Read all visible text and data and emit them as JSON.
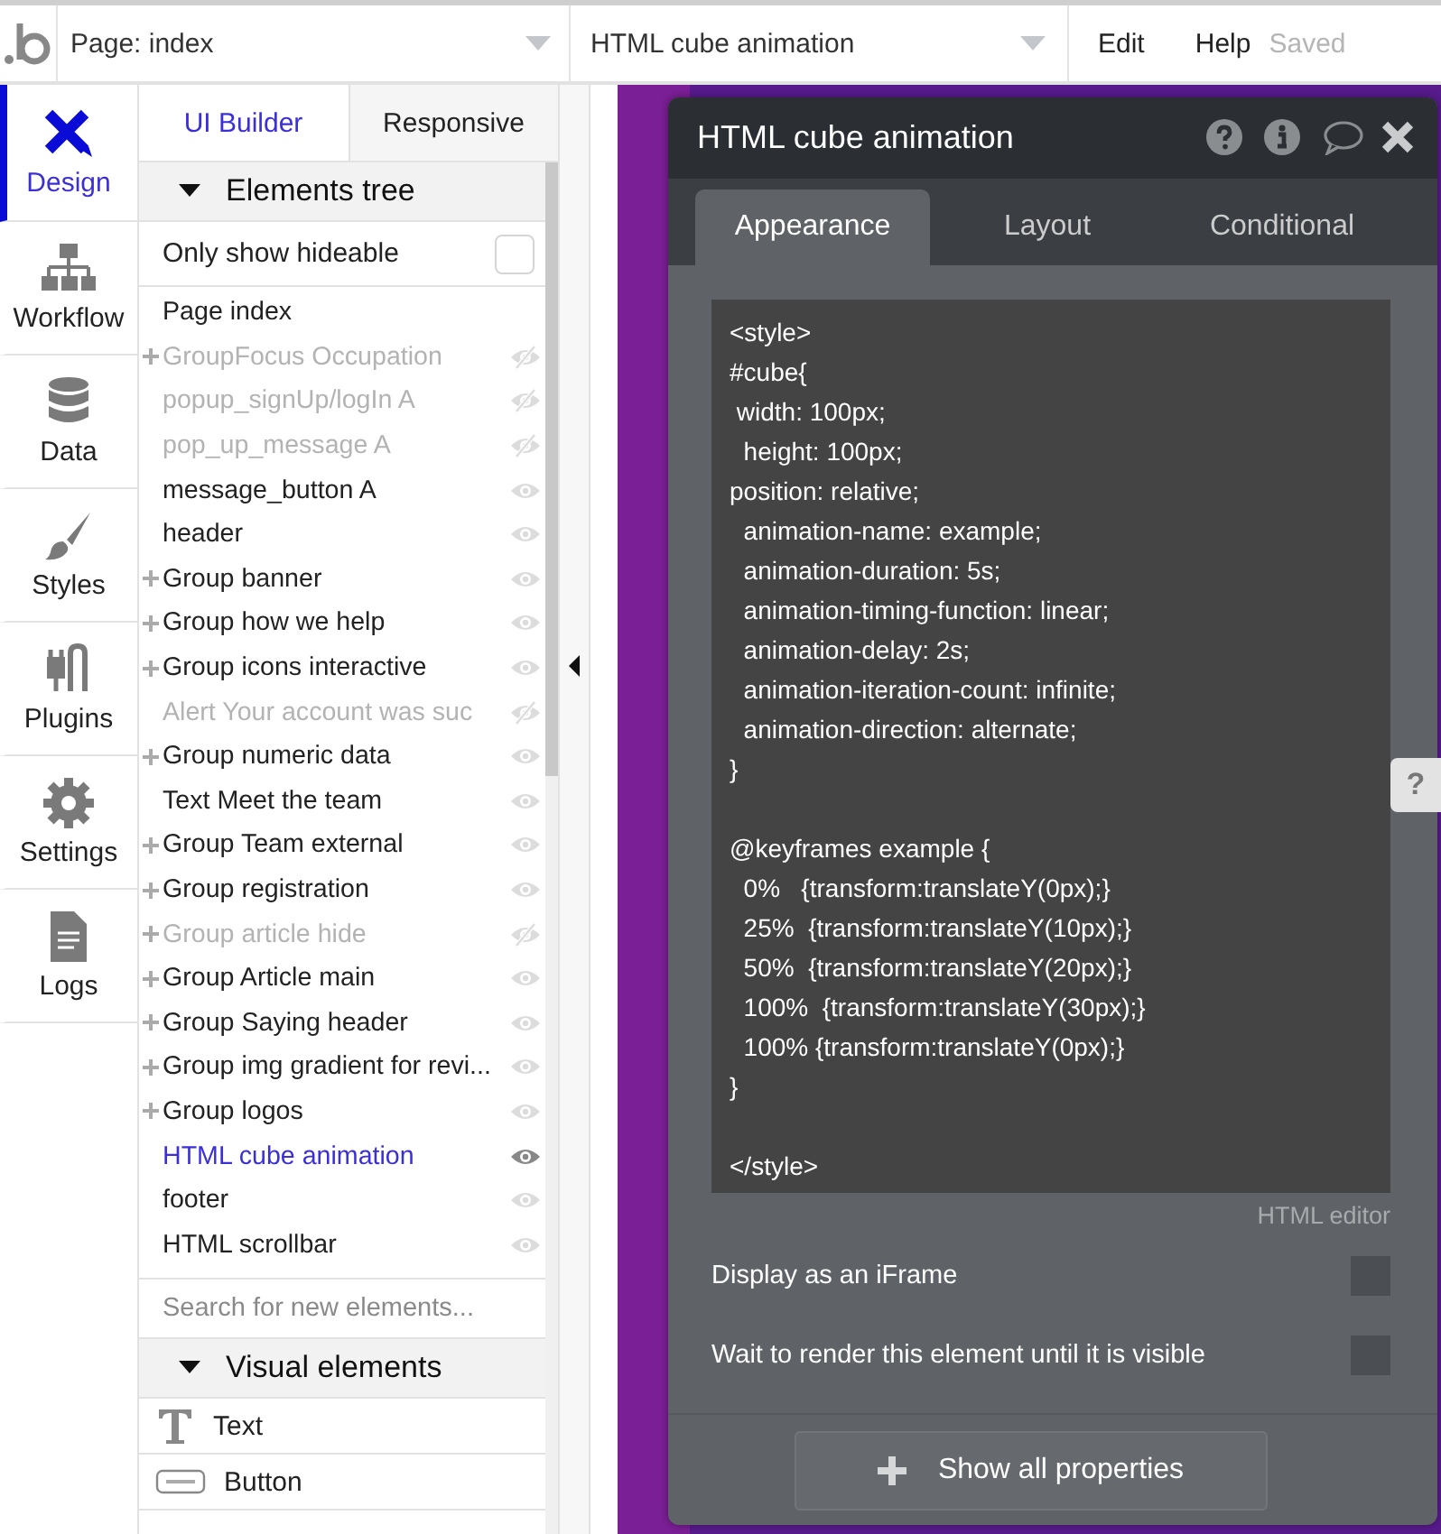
{
  "topbar": {
    "page_select": "Page: index",
    "element_select": "HTML cube animation",
    "menu": [
      {
        "label": "Edit",
        "kind": "menu"
      },
      {
        "label": "Help",
        "kind": "menu"
      },
      {
        "label": "Saved",
        "kind": "status"
      }
    ]
  },
  "sidebar": {
    "items": [
      {
        "label": "Design",
        "selected": true
      },
      {
        "label": "Workflow",
        "selected": false
      },
      {
        "label": "Data",
        "selected": false
      },
      {
        "label": "Styles",
        "selected": false
      },
      {
        "label": "Plugins",
        "selected": false
      },
      {
        "label": "Settings",
        "selected": false
      },
      {
        "label": "Logs",
        "selected": false
      }
    ]
  },
  "builder_tabs": [
    {
      "label": "UI Builder",
      "selected": true
    },
    {
      "label": "Responsive",
      "selected": false
    }
  ],
  "elements_tree": {
    "title": "Elements tree",
    "expanded": true,
    "only_show_hideable": {
      "label": "Only show hideable",
      "checked": false
    },
    "items": [
      {
        "label": "Page index",
        "kind": "page",
        "group": false,
        "hidden": false,
        "selected": false
      },
      {
        "label": "GroupFocus Occupation",
        "kind": "element",
        "group": true,
        "hidden": true,
        "selected": false
      },
      {
        "label": "popup_signUp/logIn A",
        "kind": "element",
        "group": false,
        "hidden": true,
        "selected": false
      },
      {
        "label": "pop_up_message A",
        "kind": "element",
        "group": false,
        "hidden": true,
        "selected": false
      },
      {
        "label": "message_button A",
        "kind": "element",
        "group": false,
        "hidden": false,
        "selected": false
      },
      {
        "label": "header",
        "kind": "element",
        "group": false,
        "hidden": false,
        "selected": false
      },
      {
        "label": "Group banner",
        "kind": "element",
        "group": true,
        "hidden": false,
        "selected": false
      },
      {
        "label": "Group how we help",
        "kind": "element",
        "group": true,
        "hidden": false,
        "selected": false
      },
      {
        "label": "Group icons interactive",
        "kind": "element",
        "group": true,
        "hidden": false,
        "selected": false
      },
      {
        "label": "Alert Your account was suc",
        "kind": "element",
        "group": false,
        "hidden": true,
        "selected": false
      },
      {
        "label": "Group numeric data",
        "kind": "element",
        "group": true,
        "hidden": false,
        "selected": false
      },
      {
        "label": "Text Meet the team",
        "kind": "element",
        "group": false,
        "hidden": false,
        "selected": false
      },
      {
        "label": "Group Team external",
        "kind": "element",
        "group": true,
        "hidden": false,
        "selected": false
      },
      {
        "label": "Group registration",
        "kind": "element",
        "group": true,
        "hidden": false,
        "selected": false
      },
      {
        "label": "Group article hide",
        "kind": "element",
        "group": true,
        "hidden": true,
        "selected": false
      },
      {
        "label": "Group Article main",
        "kind": "element",
        "group": true,
        "hidden": false,
        "selected": false
      },
      {
        "label": "Group Saying header",
        "kind": "element",
        "group": true,
        "hidden": false,
        "selected": false
      },
      {
        "label": "Group img gradient for revi...",
        "kind": "element",
        "group": true,
        "hidden": false,
        "selected": false
      },
      {
        "label": "Group logos",
        "kind": "element",
        "group": true,
        "hidden": false,
        "selected": false
      },
      {
        "label": "HTML cube animation",
        "kind": "element",
        "group": false,
        "hidden": false,
        "selected": true
      },
      {
        "label": "footer",
        "kind": "element",
        "group": false,
        "hidden": false,
        "selected": false
      },
      {
        "label": "HTML scrollbar",
        "kind": "element",
        "group": false,
        "hidden": false,
        "selected": false
      }
    ]
  },
  "search": {
    "placeholder": "Search for new elements..."
  },
  "visual_elements": {
    "title": "Visual elements",
    "expanded": true,
    "items": [
      {
        "label": "Text",
        "kind": "text"
      },
      {
        "label": "Button",
        "kind": "button"
      }
    ]
  },
  "property_editor": {
    "title": "HTML cube animation",
    "tabs": [
      {
        "label": "Appearance",
        "selected": true
      },
      {
        "label": "Layout",
        "selected": false
      },
      {
        "label": "Conditional",
        "selected": false
      }
    ],
    "code": "<style>\n#cube{\n width: 100px;\n  height: 100px;\nposition: relative;\n  animation-name: example;\n  animation-duration: 5s;\n  animation-timing-function: linear;\n  animation-delay: 2s;\n  animation-iteration-count: infinite;\n  animation-direction: alternate;\n}\n\n@keyframes example {\n  0%   {transform:translateY(0px);}\n  25%  {transform:translateY(10px);}\n  50%  {transform:translateY(20px);}\n  100%  {transform:translateY(30px);}\n  100% {transform:translateY(0px);}\n}\n\n</style>",
    "editor_label": "HTML editor",
    "options": [
      {
        "label": "Display as an iFrame",
        "checked": false
      },
      {
        "label": "Wait to render this element until it is visible",
        "checked": false
      }
    ],
    "show_all_button": "Show all properties"
  },
  "canvas_help": "?"
}
